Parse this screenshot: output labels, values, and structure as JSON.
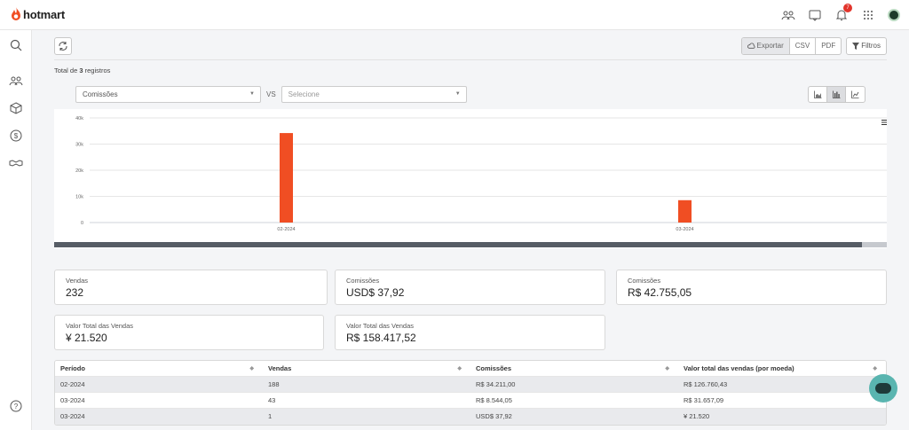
{
  "app": {
    "brand": "hotmart",
    "notifications": "7"
  },
  "toolbar": {
    "export_label": "Exportar",
    "csv_label": "CSV",
    "pdf_label": "PDF",
    "filter_label": "Filtros"
  },
  "summary": {
    "prefix": "Total de",
    "count": "3",
    "suffix": "registros"
  },
  "selectors": {
    "primary": "Comissões",
    "vs": "VS",
    "secondary": "Selecione"
  },
  "chart_data": {
    "type": "bar",
    "categories": [
      "02-2024",
      "03-2024"
    ],
    "values": [
      34211,
      8544
    ],
    "yticks": [
      "0",
      "10k",
      "20k",
      "30k",
      "40k"
    ],
    "ylim": [
      0,
      40000
    ],
    "grid": true,
    "color": "#f04e23"
  },
  "cards": [
    {
      "label": "Vendas",
      "value": "232"
    },
    {
      "label": "Comissões",
      "value": "USD$ 37,92"
    },
    {
      "label": "Comissões",
      "value": "R$ 42.755,05"
    },
    {
      "label": "Valor Total das Vendas",
      "value": "¥ 21.520"
    },
    {
      "label": "Valor Total das Vendas",
      "value": "R$ 158.417,52"
    }
  ],
  "table": {
    "headers": [
      "Período",
      "Vendas",
      "Comissões",
      "Valor total das vendas (por moeda)"
    ],
    "rows": [
      [
        "02-2024",
        "188",
        "R$ 34.211,00",
        "R$ 126.760,43"
      ],
      [
        "03-2024",
        "43",
        "R$ 8.544,05",
        "R$ 31.657,09"
      ],
      [
        "03-2024",
        "1",
        "USD$ 37,92",
        "¥ 21.520"
      ]
    ]
  },
  "colors": {
    "brand": "#f04e23",
    "chat": "#5ab5b0",
    "badge": "#e2342b"
  }
}
